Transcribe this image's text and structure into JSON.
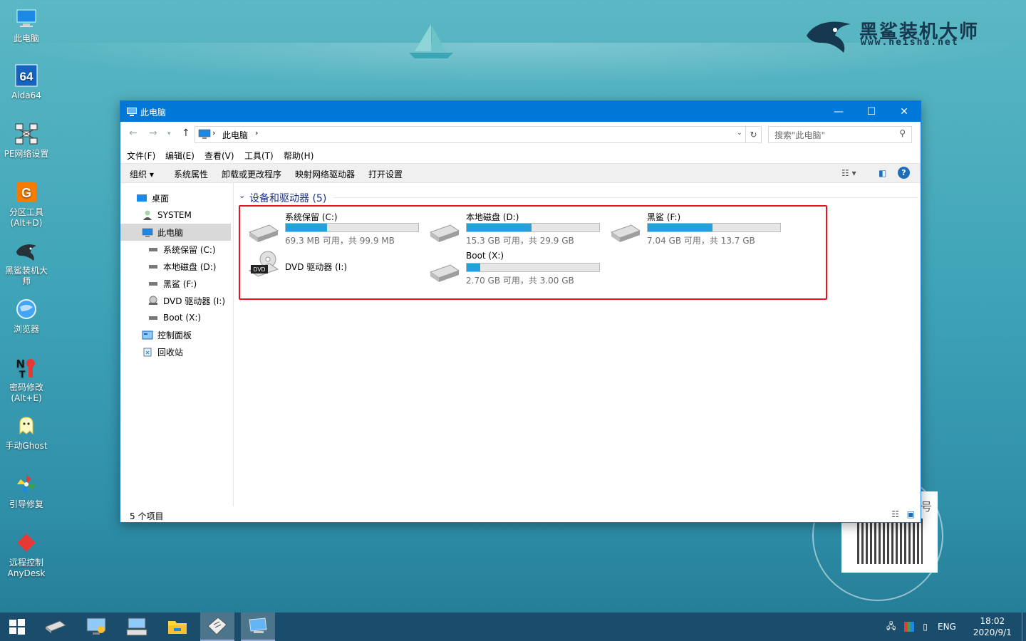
{
  "brand": {
    "cn": "黑鲨装机大师",
    "en": "www.heisha.net"
  },
  "desktop": [
    {
      "label": "此电脑",
      "icon": "computer-icon"
    },
    {
      "label": "Aida64",
      "icon": "aida64-icon"
    },
    {
      "label": "PE网络设置",
      "icon": "network-icon"
    },
    {
      "label": "分区工具\n(Alt+D)",
      "icon": "partition-icon"
    },
    {
      "label": "黑鲨装机大\n师",
      "icon": "shark-icon"
    },
    {
      "label": "浏览器",
      "icon": "browser-icon"
    },
    {
      "label": "密码修改\n(Alt+E)",
      "icon": "password-icon"
    },
    {
      "label": "手动Ghost",
      "icon": "ghost-icon"
    },
    {
      "label": "引导修复",
      "icon": "boot-repair-icon"
    },
    {
      "label": "远程控制\nAnyDesk",
      "icon": "anydesk-icon"
    }
  ],
  "qr": {
    "title": "号"
  },
  "window": {
    "title": "此电脑",
    "controls": {
      "minimize": "—",
      "maximize": "☐",
      "close": "✕"
    },
    "address": "此电脑",
    "search_placeholder": "搜索\"此电脑\"",
    "menus": [
      "文件(F)",
      "编辑(E)",
      "查看(V)",
      "工具(T)",
      "帮助(H)"
    ],
    "commands": [
      "组织 ▾",
      "系统属性",
      "卸载或更改程序",
      "映射网络驱动器",
      "打开设置"
    ],
    "nav": [
      {
        "label": "桌面",
        "indent": 0
      },
      {
        "label": "SYSTEM",
        "indent": 0
      },
      {
        "label": "此电脑",
        "indent": 0,
        "selected": true
      },
      {
        "label": "系统保留 (C:)",
        "indent": 1
      },
      {
        "label": "本地磁盘 (D:)",
        "indent": 1
      },
      {
        "label": "黑鲨 (F:)",
        "indent": 1
      },
      {
        "label": "DVD 驱动器 (I:)",
        "indent": 1
      },
      {
        "label": "Boot (X:)",
        "indent": 1
      },
      {
        "label": "控制面板",
        "indent": 0
      },
      {
        "label": "回收站",
        "indent": 0
      }
    ],
    "group_title": "设备和驱动器 (5)",
    "drives": [
      {
        "name": "系统保留 (C:)",
        "size": "69.3 MB 可用，共 99.9 MB",
        "used": 0.31
      },
      {
        "name": "本地磁盘 (D:)",
        "size": "15.3 GB 可用，共 29.9 GB",
        "used": 0.49
      },
      {
        "name": "黑鲨 (F:)",
        "size": "7.04 GB 可用，共 13.7 GB",
        "used": 0.49
      },
      {
        "name": "DVD 驱动器 (I:)",
        "size": "",
        "used": null
      },
      {
        "name": "Boot (X:)",
        "size": "2.70 GB 可用，共 3.00 GB",
        "used": 0.1
      }
    ],
    "status": "5 个项目"
  },
  "tray": {
    "lang": "ENG",
    "time": "18:02",
    "date": "2020/9/1"
  }
}
